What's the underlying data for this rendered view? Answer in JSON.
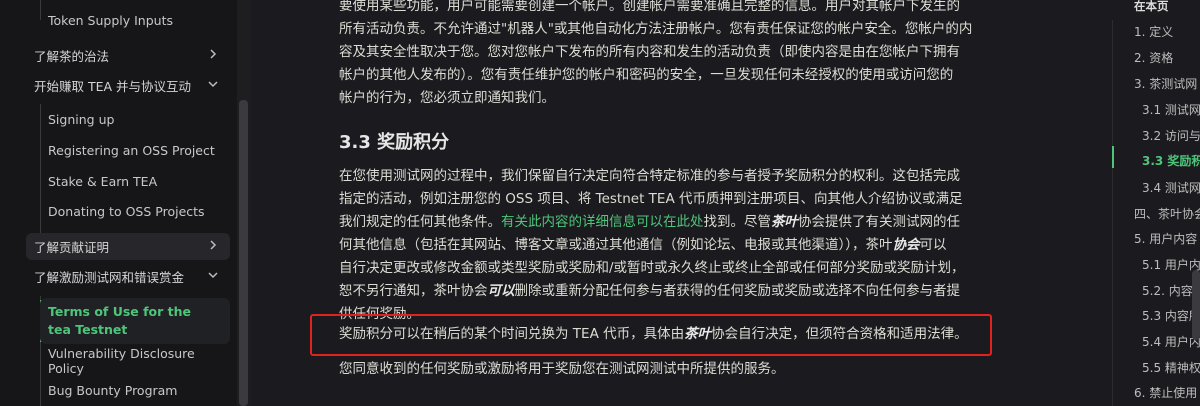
{
  "sidebar": {
    "items": [
      {
        "label": "Token Supply Inputs"
      },
      {
        "label": "了解茶的治法"
      },
      {
        "label": "开始赚取 TEA 并与协议互动"
      },
      {
        "label": "Signing up"
      },
      {
        "label": "Registering an OSS Project"
      },
      {
        "label": "Stake & Earn TEA"
      },
      {
        "label": "Donating to OSS Projects"
      },
      {
        "label": "了解贡献证明"
      },
      {
        "label": "了解激励测试网和错误赏金"
      },
      {
        "label": "Terms of Use for the tea Testnet"
      },
      {
        "label": "Vulnerability Disclosure Policy"
      },
      {
        "label": "Bug Bounty Program"
      }
    ]
  },
  "content": {
    "p1_l1": "要使用某些功能，用户可能需要创建一个帐户。创建帐户需要准确且完整的信息。用户对其帐户下发生的",
    "p1_l2": "所有活动负责。不允许通过\"机器人\"或其他自动化方法注册帐户。您有责任保证您的帐户安全。您帐户的内",
    "p1_l3": "容及其安全性取决于您。您对您帐户下发布的所有内容和发生的活动负责（即使内容是由在您帐户下拥有",
    "p1_l4": "帐户的其他人发布的）。您有责任维护您的帐户和密码的安全，一旦发现任何未经授权的使用或访问您的",
    "p1_l5": "帐户的行为，您必须立即通知我们。",
    "heading": "3.3 奖励积分",
    "p2_l1": "在您使用测试网的过程中，我们保留自行决定向符合特定标准的参与者授予奖励积分的权利。这包括完成",
    "p2_l2": "指定的活动，例如注册您的 OSS 项目、将 Testnet TEA 代币质押到注册项目、向其他人介绍协议或满足",
    "p2_l3a": "我们规定的任何其他条件。",
    "p2_link": "有关此内容的详细信息可以在此处",
    "p2_l3b": "找到。尽管",
    "p2_em1": "茶叶",
    "p2_l3c": "协会提供了有关测试网的任",
    "p2_l4": "何其他信息（包括在其网站、博客文章或通过其他通信（例如论坛、电报或其他渠道）），茶叶",
    "p2_em2": "协会",
    "p2_l4b": "可以",
    "p2_l5": "自行决定更改或修改金额或类型奖励或奖励和/或暂时或永久终止或终止全部或任何部分奖励或奖励计划，",
    "p2_l6a": "恕不另行通知，茶叶协会",
    "p2_em3": "可以",
    "p2_l6b": "删除或重新分配任何参与者获得的任何奖励或奖励或选择不向任何参与者提",
    "p2_l7": "供任何奖励。",
    "p3a": "奖励积分可以在稍后的某个时间兑换为 TEA 代币，具体由",
    "p3_em": "茶叶",
    "p3b": "协会自行决定，但须符合资格和适用法律。",
    "p4": "您同意收到的任何奖励或激励将用于奖励您在测试网测试中所提供的服务。"
  },
  "toc": {
    "title": "在本页",
    "items": [
      {
        "label": "1. 定义"
      },
      {
        "label": "2. 资格"
      },
      {
        "label": "3. 茶测试网"
      },
      {
        "label": "3.1 测试网接"
      },
      {
        "label": "3.2 访问与"
      },
      {
        "label": "3.3 奖励积"
      },
      {
        "label": "3.4 测试网"
      },
      {
        "label": "四、茶叶协会"
      },
      {
        "label": "5. 用户内容"
      },
      {
        "label": "5.1 用户内容"
      },
      {
        "label": "5.2. 内容审"
      },
      {
        "label": "5.3 内容所"
      },
      {
        "label": "5.4 用户内"
      },
      {
        "label": "5.5 精神权"
      },
      {
        "label": "6. 禁止使用"
      }
    ]
  },
  "icons": {
    "chevron_right": "chevron-right-icon",
    "chevron_down": "chevron-down-icon"
  },
  "colors": {
    "accent": "#4ec57a",
    "highlight_border": "#e0231f",
    "background": "#1b1b1f"
  }
}
